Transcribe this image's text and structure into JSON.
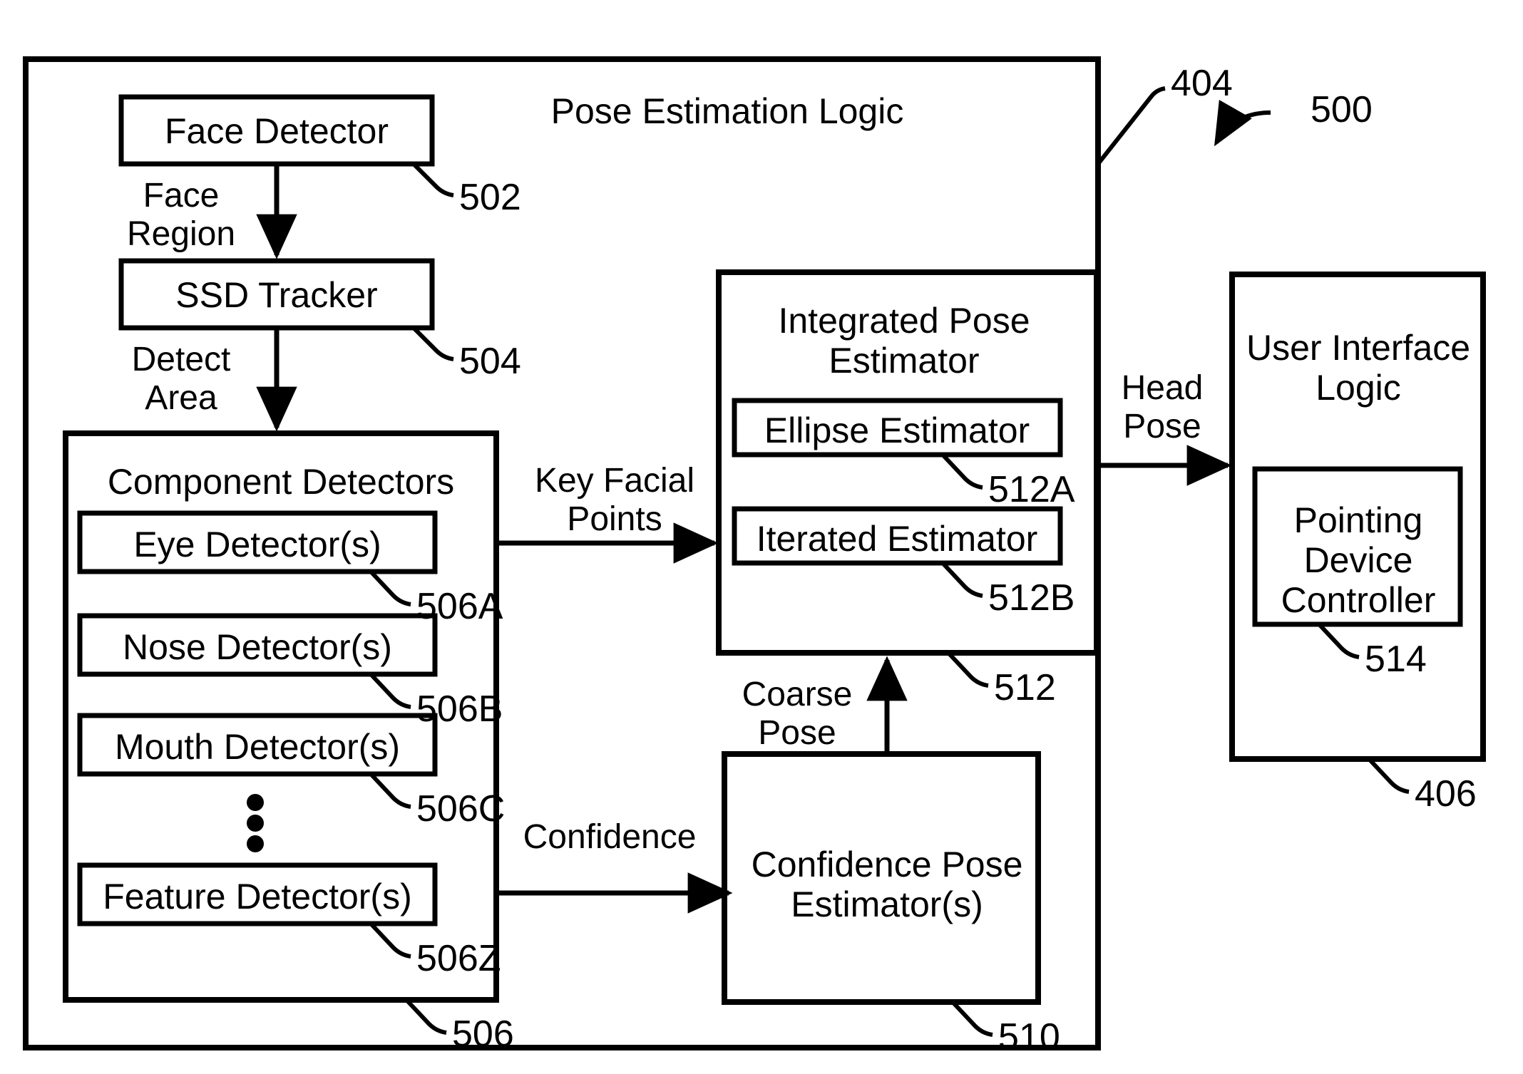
{
  "figure": {
    "number": "500",
    "outer_container": {
      "title": "Pose Estimation Logic",
      "ref": "404"
    }
  },
  "blocks": [
    {
      "id": "face-detector",
      "label": "Face Detector",
      "ref": "502"
    },
    {
      "id": "ssd-tracker",
      "label": "SSD Tracker",
      "ref": "504"
    },
    {
      "id": "component-detectors",
      "label": "Component Detectors",
      "ref": "506"
    },
    {
      "id": "eye-detector",
      "label": "Eye Detector(s)",
      "ref": "506A"
    },
    {
      "id": "nose-detector",
      "label": "Nose Detector(s)",
      "ref": "506B"
    },
    {
      "id": "mouth-detector",
      "label": "Mouth Detector(s)",
      "ref": "506C"
    },
    {
      "id": "feature-detector",
      "label": "Feature Detector(s)",
      "ref": "506Z"
    },
    {
      "id": "integrated-pose-estimator",
      "label": "Integrated Pose\nEstimator",
      "ref": "512"
    },
    {
      "id": "ellipse-estimator",
      "label": "Ellipse Estimator",
      "ref": "512A"
    },
    {
      "id": "iterated-estimator",
      "label": "Iterated Estimator",
      "ref": "512B"
    },
    {
      "id": "confidence-pose-estimator",
      "label": "Confidence Pose\nEstimator(s)",
      "ref": "510"
    },
    {
      "id": "user-interface-logic",
      "label": "User Interface\nLogic",
      "ref": "406"
    },
    {
      "id": "pointing-device-controller",
      "label": "Pointing\nDevice\nController",
      "ref": "514"
    }
  ],
  "edges": [
    {
      "id": "face-region",
      "label": "Face\nRegion"
    },
    {
      "id": "detect-area",
      "label": "Detect\nArea"
    },
    {
      "id": "key-facial-points",
      "label": "Key Facial\nPoints"
    },
    {
      "id": "confidence",
      "label": "Confidence"
    },
    {
      "id": "coarse-pose",
      "label": "Coarse\nPose"
    },
    {
      "id": "head-pose",
      "label": "Head\nPose"
    }
  ],
  "ellipsis": "vertical-ellipsis",
  "colors": {
    "stroke": "#000000",
    "background": "#ffffff"
  }
}
